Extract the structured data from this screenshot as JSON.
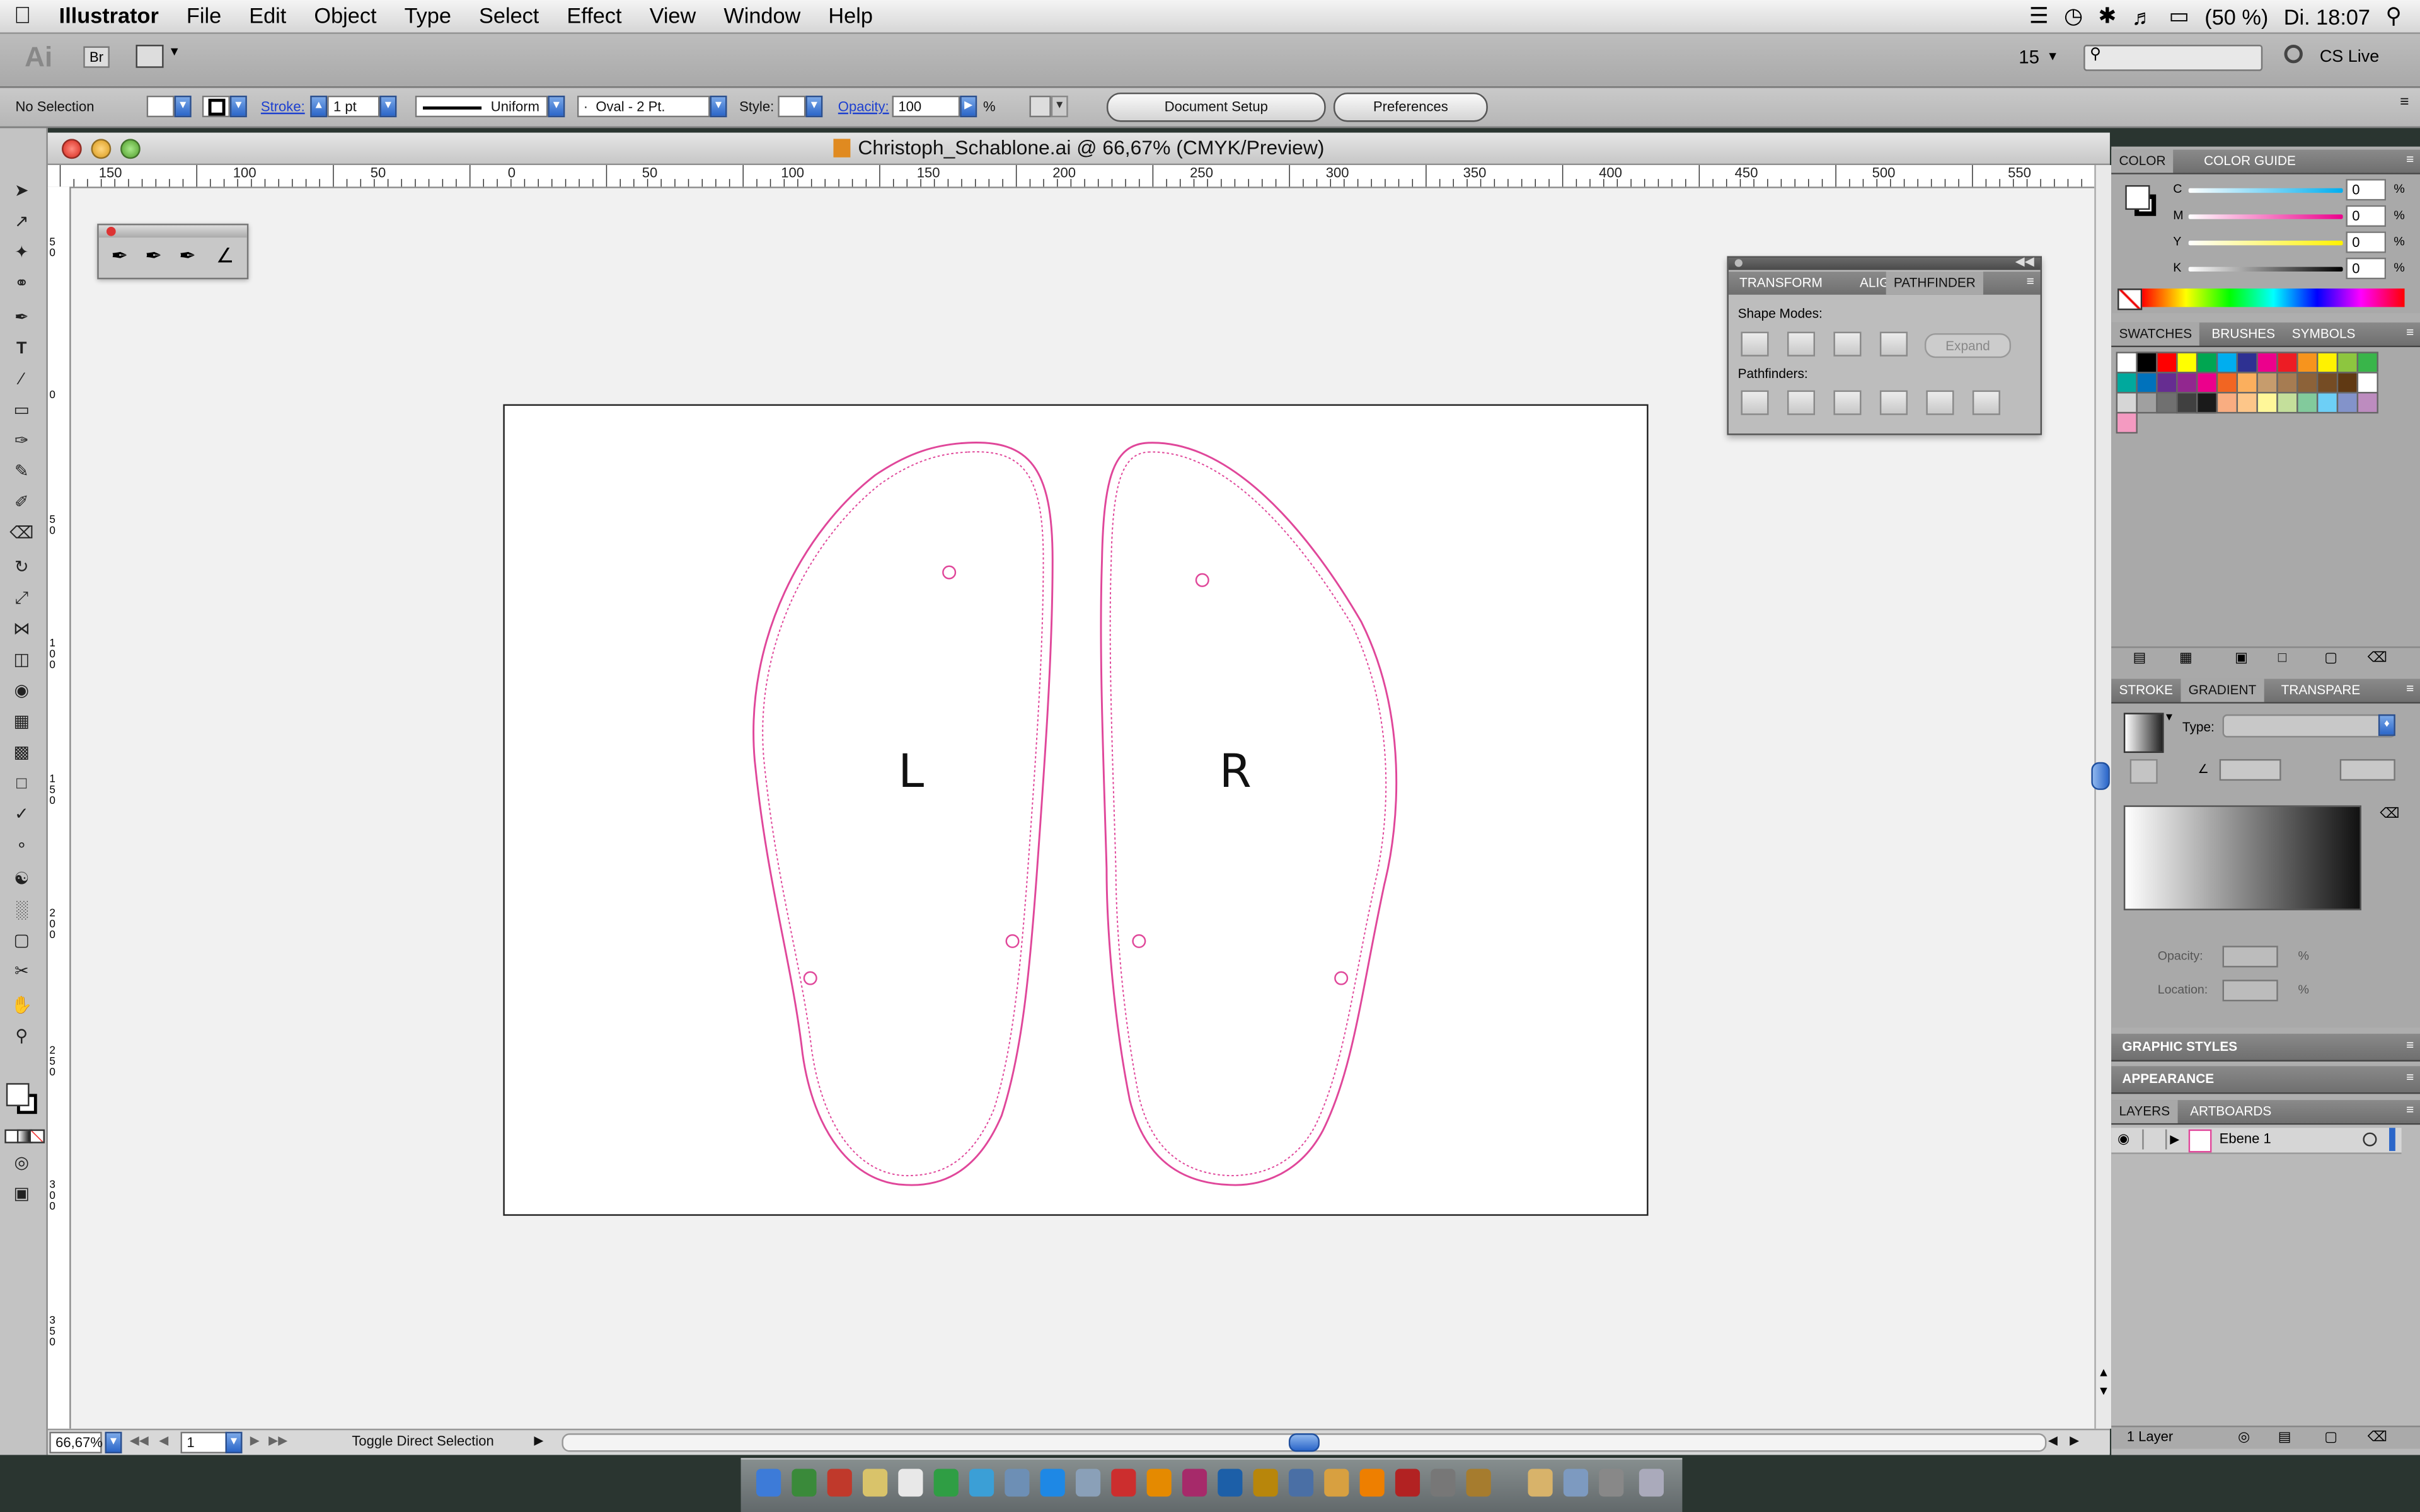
{
  "menubar": {
    "app_name": "Illustrator",
    "items": [
      "File",
      "Edit",
      "Object",
      "Type",
      "Select",
      "Effect",
      "View",
      "Window",
      "Help"
    ],
    "battery": "(50 %)",
    "clock": "Di. 18:07"
  },
  "appbar": {
    "logo": "Ai",
    "bridge": "Br",
    "workspace_value": "15",
    "cs_live": "CS Live"
  },
  "control": {
    "selection_status": "No Selection",
    "stroke_label": "Stroke:",
    "stroke_value": "1 pt",
    "profile": "Uniform",
    "brush": "Oval - 2 Pt.",
    "style_label": "Style:",
    "opacity_label": "Opacity:",
    "opacity_value": "100",
    "opacity_unit": "%",
    "document_setup": "Document Setup",
    "preferences": "Preferences"
  },
  "document": {
    "title": "Christoph_Schablone.ai @ 66,67% (CMYK/Preview)",
    "ruler_labels": [
      "150",
      "100",
      "50",
      "0",
      "50",
      "100",
      "150",
      "200",
      "250",
      "300",
      "350",
      "400",
      "450",
      "500",
      "550"
    ],
    "vruler_labels": [
      "5 0",
      "0",
      "5 0",
      "1 0 0",
      "1 5 0",
      "2 0 0",
      "2 5 0",
      "3 0 0",
      "3 5 0"
    ],
    "left_label": "L",
    "right_label": "R",
    "status_zoom": "66,67%",
    "status_page": "1",
    "status_tool": "Toggle Direct Selection"
  },
  "pathfinder": {
    "tabs": [
      "TRANSFORM",
      "ALIGN",
      "PATHFINDER"
    ],
    "shape_modes": "Shape Modes:",
    "expand": "Expand",
    "pathfinders": "Pathfinders:"
  },
  "color_panel": {
    "tabs": [
      "COLOR",
      "COLOR GUIDE"
    ],
    "channels": [
      {
        "name": "C",
        "value": "0"
      },
      {
        "name": "M",
        "value": "0"
      },
      {
        "name": "Y",
        "value": "0"
      },
      {
        "name": "K",
        "value": "0"
      }
    ],
    "unit": "%"
  },
  "swatches_panel": {
    "tabs": [
      "SWATCHES",
      "BRUSHES",
      "SYMBOLS"
    ],
    "colors": [
      "#ffffff",
      "#000000",
      "#ff0000",
      "#ffff00",
      "#00a651",
      "#00aeef",
      "#2e3192",
      "#ec008c",
      "#ed1c24",
      "#f7941d",
      "#fff200",
      "#8dc63f",
      "#39b54a",
      "#00a99d",
      "#0072bc",
      "#662d91",
      "#92278f",
      "#ec008c",
      "#f26522",
      "#fbaf5d",
      "#c69c6d",
      "#a67c52",
      "#8c6239",
      "#754c24",
      "#603913",
      "#ffffff",
      "#d6d6d6",
      "#a0a0a0",
      "#707070",
      "#404040",
      "#1a1a1a",
      "#f9ad81",
      "#fdc689",
      "#fff799",
      "#c4df9b",
      "#82ca9c",
      "#6dcff6",
      "#8393ca",
      "#bd8cbf",
      "#f49ac1"
    ]
  },
  "gradient_panel": {
    "tabs": [
      "STROKE",
      "GRADIENT",
      "TRANSPARE"
    ],
    "type_label": "Type:",
    "opacity_label": "Opacity:",
    "location_label": "Location:",
    "unit": "%"
  },
  "graphic_styles": "GRAPHIC STYLES",
  "appearance": "APPEARANCE",
  "layers_panel": {
    "tabs": [
      "LAYERS",
      "ARTBOARDS"
    ],
    "layer_name": "Ebene 1",
    "footer": "1 Layer"
  },
  "colors": {
    "outline_pink": "#e0479a",
    "accent_blue": "#2b66c9"
  }
}
